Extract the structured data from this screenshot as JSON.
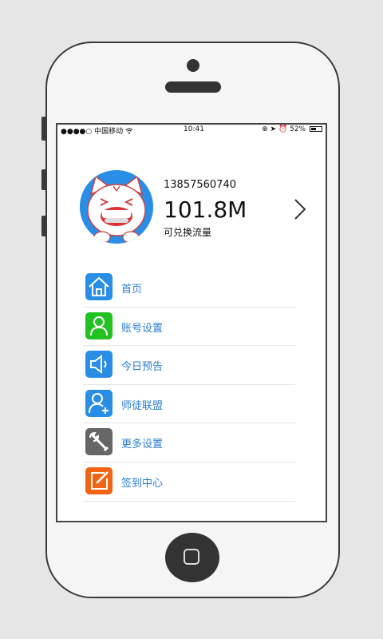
{
  "status_bar": {
    "carrier": "●●●●○ 中国移动",
    "time": "10:41",
    "battery_text": "52%",
    "battery_level": 0.52
  },
  "profile": {
    "phone_number": "13857560740",
    "balance": "101.8M",
    "balance_label": "可兑换流量"
  },
  "menu": {
    "items": [
      {
        "label": "首页",
        "icon": "home-icon",
        "color": "#2b8ee6"
      },
      {
        "label": "账号设置",
        "icon": "user-icon",
        "color": "#22c222"
      },
      {
        "label": "今日预告",
        "icon": "speaker-icon",
        "color": "#2b8ee6"
      },
      {
        "label": "师徒联盟",
        "icon": "add-user-icon",
        "color": "#2b8ee6"
      },
      {
        "label": "更多设置",
        "icon": "wrench-icon",
        "color": "#666666"
      },
      {
        "label": "签到中心",
        "icon": "edit-icon",
        "color": "#f06414"
      }
    ]
  }
}
